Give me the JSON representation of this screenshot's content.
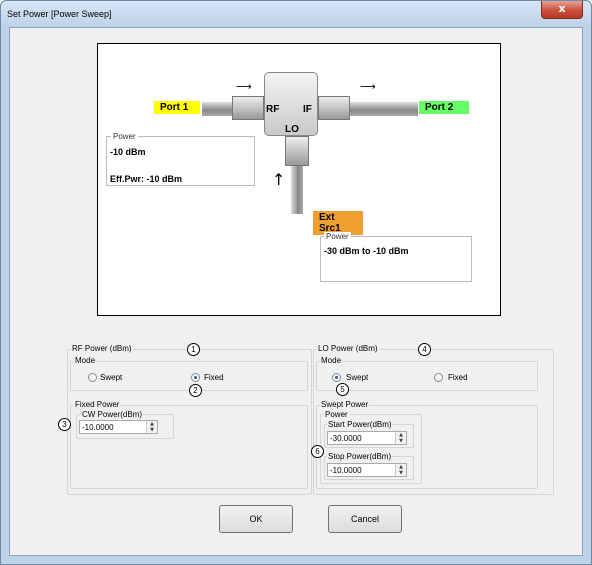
{
  "window": {
    "title": "Set Power [Power Sweep]",
    "close_glyph": "x"
  },
  "diagram": {
    "port1": "Port 1",
    "port2": "Port 2",
    "ext_src": "Ext Src1",
    "rf": "RF",
    "if": "IF",
    "lo": "LO",
    "rf_power_box": {
      "label": "Power",
      "value": "-10  dBm",
      "eff_power": "Eff.Pwr: -10  dBm"
    },
    "lo_power_box": {
      "label": "Power",
      "value": "-30 dBm to -10 dBm"
    },
    "arrow_right": "⟶",
    "arrow_up": "↑"
  },
  "rf_power": {
    "group_label": "RF Power (dBm)",
    "mode_label": "Mode",
    "swept_label": "Swept",
    "fixed_label": "Fixed",
    "selected": "Fixed",
    "fixed_power_label": "Fixed Power",
    "cw_power_label": "CW Power(dBm)",
    "cw_power_value": "-10.0000"
  },
  "lo_power": {
    "group_label": "LO Power (dBm)",
    "mode_label": "Mode",
    "swept_label": "Swept",
    "fixed_label": "Fixed",
    "selected": "Swept",
    "swept_power_label": "Swept Power",
    "power_label": "Power",
    "start_label": "Start Power(dBm)",
    "start_value": "-30.0000",
    "stop_label": "Stop Power(dBm)",
    "stop_value": "-10.0000"
  },
  "callouts": [
    "1",
    "2",
    "3",
    "4",
    "5",
    "6"
  ],
  "buttons": {
    "ok": "OK",
    "cancel": "Cancel"
  },
  "spin_glyphs": {
    "up": "▲",
    "down": "▼"
  }
}
